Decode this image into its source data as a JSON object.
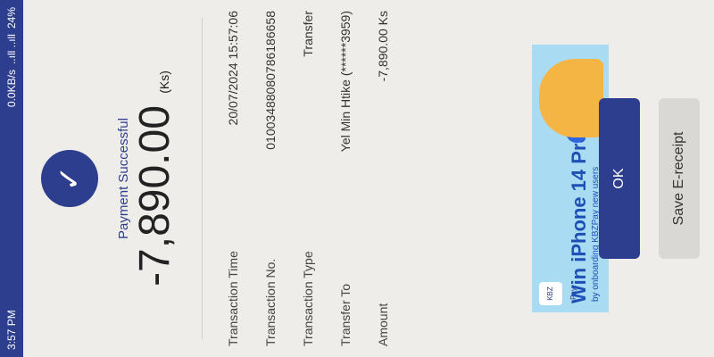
{
  "status_bar": {
    "time": "3:57 PM",
    "network_speed": "0.0KB/s",
    "signal": "..ıll ..ıll",
    "battery": "24%"
  },
  "receipt": {
    "status_title": "Payment Successful",
    "amount": "-7,890.00",
    "currency_unit": "(Ks)",
    "rows": [
      {
        "label": "Transaction Time",
        "value": "20/07/2024 15:57:06"
      },
      {
        "label": "Transaction No.",
        "value": "01003488080786186658"
      },
      {
        "label": "Transaction Type",
        "value": "Transfer"
      },
      {
        "label": "Transfer To",
        "value": "Yel Min Htike (******3959)"
      },
      {
        "label": "Amount",
        "value": "-7,890.00 Ks"
      }
    ]
  },
  "banner": {
    "logo_text": "KBZ Pay",
    "title": "Win iPhone 14 Pro",
    "subtitle": "by onboarding KBZPay new users"
  },
  "actions": {
    "ok_label": "OK",
    "save_label": "Save E-receipt"
  },
  "colors": {
    "brand": "#2d3e8f",
    "banner_bg": "#a9dbf2"
  }
}
